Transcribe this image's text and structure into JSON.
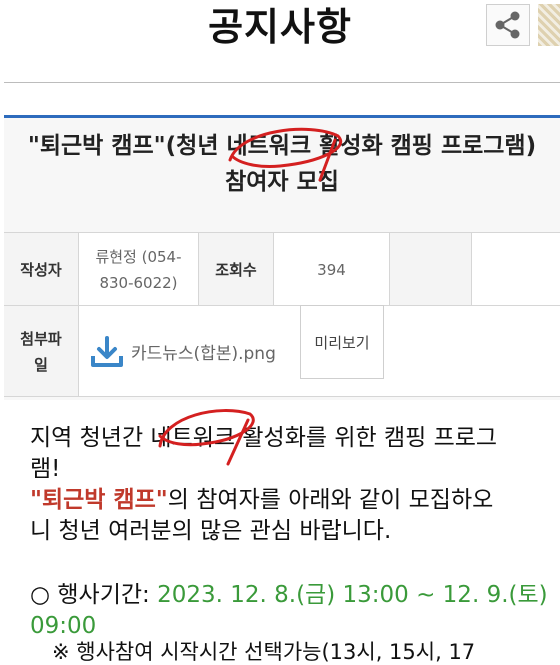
{
  "header": {
    "title": "공지사항"
  },
  "post": {
    "title_line1": "\"퇴근박 캠프\"(청년 네트워크 활성화 캠핑 프로그램)",
    "title_line2": "참여자 모집"
  },
  "info": {
    "author_label": "작성자",
    "author_value_line1": "류현정 (054-",
    "author_value_line2": "830-6022)",
    "views_label": "조회수",
    "views_value": "394",
    "attachment_label_line1": "첨부파",
    "attachment_label_line2": "일",
    "file_name": "카드뉴스(합본).png",
    "preview_label": "미리보기"
  },
  "body": {
    "line1": "지역 청년간 네트워크 활성화를 위한 캠핑 프로그",
    "line2": "램!",
    "camp_name": "\"퇴근박 캠프\"",
    "line3_rest": "의 참여자를 아래와 같이 모집하오",
    "line4": "니 청년 여러분의 많은 관심 바랍니다.",
    "schedule_bullet": "○ 행사기간:",
    "schedule_value_line1": "2023. 12. 8.(금) 13:00 ~ 12. 9.(토)",
    "schedule_value_line2": "09:00",
    "note": "※ 행사참여 시작시간 선택가능(13시, 15시, 17"
  },
  "colors": {
    "accent_red": "#c0392b",
    "schedule_green": "#3a9a3a",
    "panel_border_blue": "#2d6bbd"
  },
  "icons": [
    "share-icon",
    "download-icon"
  ]
}
